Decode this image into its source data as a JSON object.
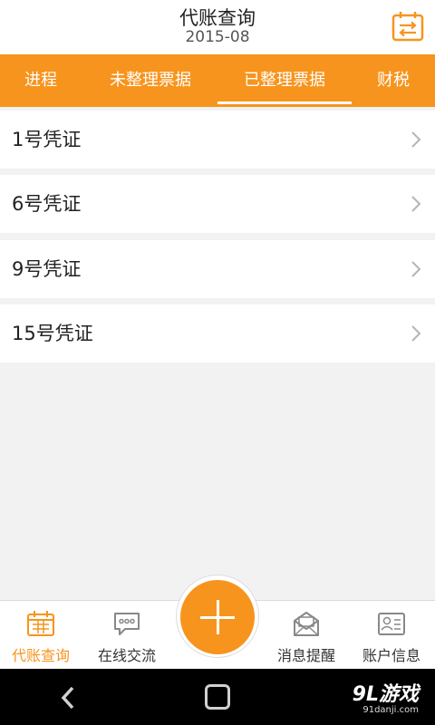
{
  "header": {
    "title": "代账查询",
    "subtitle": "2015-08",
    "calendar_icon": "calendar-swap-icon"
  },
  "tabs": [
    {
      "label": "进程",
      "active": false
    },
    {
      "label": "未整理票据",
      "active": false
    },
    {
      "label": "已整理票据",
      "active": true
    },
    {
      "label": "财税",
      "active": false
    }
  ],
  "vouchers": [
    {
      "label": "1号凭证"
    },
    {
      "label": "6号凭证"
    },
    {
      "label": "9号凭证"
    },
    {
      "label": "15号凭证"
    }
  ],
  "bottom_nav": {
    "items": [
      {
        "label": "代账查询",
        "icon": "calendar-icon",
        "active": true
      },
      {
        "label": "在线交流",
        "icon": "chat-icon",
        "active": false
      },
      {
        "label": "消息提醒",
        "icon": "mail-icon",
        "active": false
      },
      {
        "label": "账户信息",
        "icon": "id-card-icon",
        "active": false
      }
    ],
    "fab_icon": "plus-icon"
  },
  "system_bar": {
    "watermark": "9L游戏",
    "watermark_url": "91danji.com"
  },
  "colors": {
    "accent": "#f7941d",
    "background": "#f2f2f2"
  }
}
